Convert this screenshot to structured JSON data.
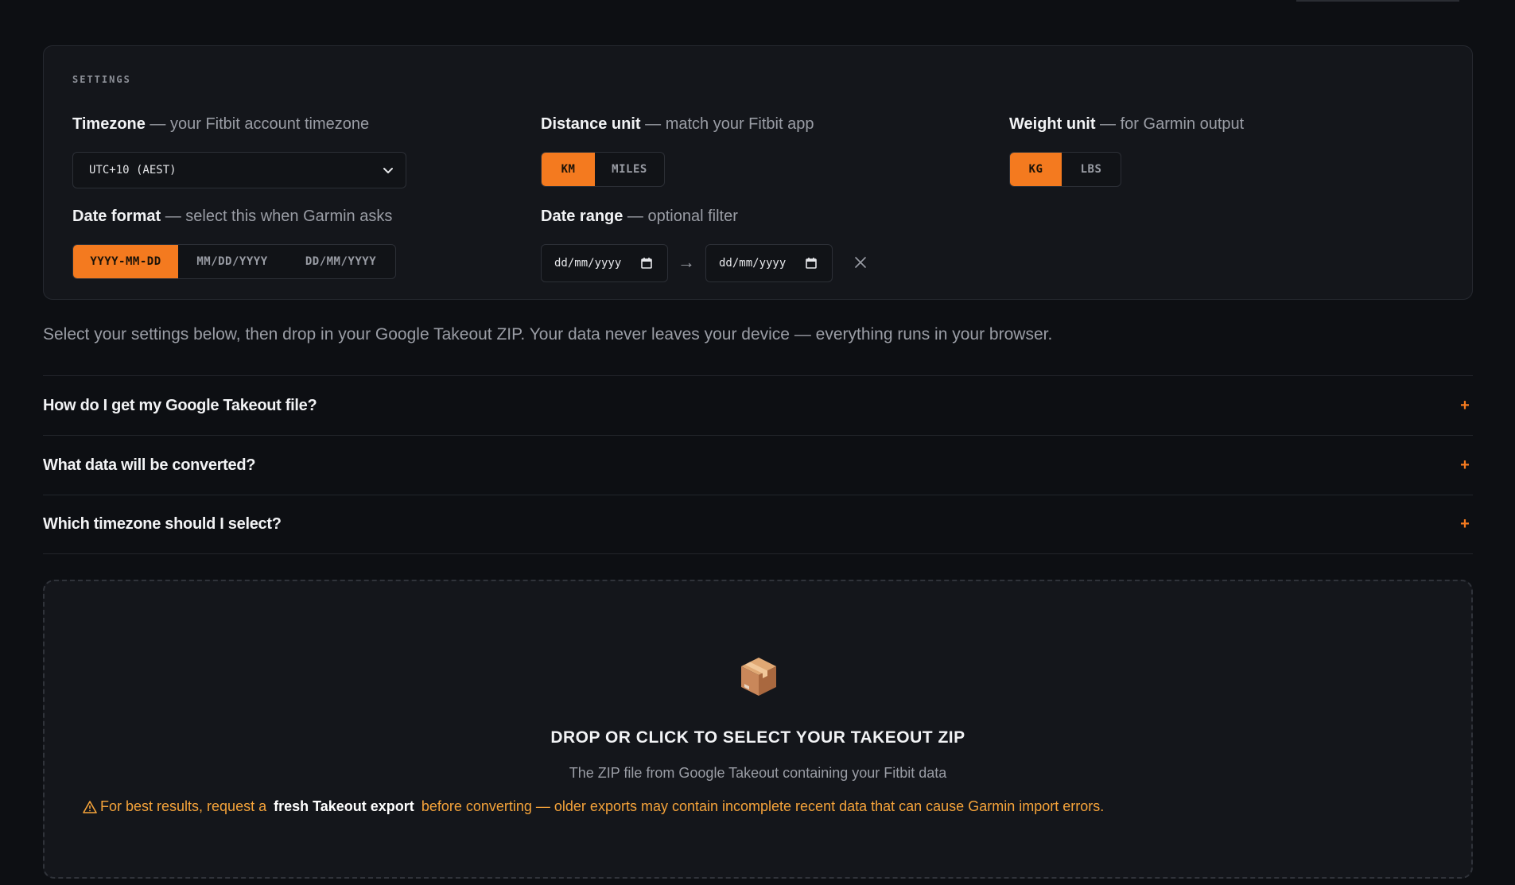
{
  "settings": {
    "heading": "SETTINGS",
    "timezone": {
      "label": "Timezone",
      "hint": " — your Fitbit account timezone",
      "value": "UTC+10 (AEST)"
    },
    "distance_unit": {
      "label": "Distance unit",
      "hint": " — match your Fitbit app",
      "options": [
        "KM",
        "MILES"
      ],
      "selected": "KM"
    },
    "weight_unit": {
      "label": "Weight unit",
      "hint": " — for Garmin output",
      "options": [
        "KG",
        "LBS"
      ],
      "selected": "KG"
    },
    "date_format": {
      "label": "Date format",
      "hint": " — select this when Garmin asks",
      "options": [
        "YYYY-MM-DD",
        "MM/DD/YYYY",
        "DD/MM/YYYY"
      ],
      "selected": "YYYY-MM-DD"
    },
    "date_range": {
      "label": "Date range",
      "hint": " — optional filter",
      "start_placeholder": "dd/mm/yyyy",
      "end_placeholder": "dd/mm/yyyy",
      "arrow": "→"
    }
  },
  "intro_text": "Select your settings below, then drop in your Google Takeout ZIP. Your data never leaves your device — everything runs in your browser.",
  "faq": [
    {
      "question": "How do I get my Google Takeout file?"
    },
    {
      "question": "What data will be converted?"
    },
    {
      "question": "Which timezone should I select?"
    }
  ],
  "faq_toggle": "+",
  "dropzone": {
    "title": "DROP OR CLICK TO SELECT YOUR TAKEOUT ZIP",
    "subtitle": "The ZIP file from Google Takeout containing your Fitbit data",
    "warning_before": "For best results, request a",
    "warning_strong": "fresh Takeout export",
    "warning_after": "before converting — older exports may contain incomplete recent data that can cause Garmin import errors."
  },
  "colors": {
    "accent": "#f47a1f",
    "warning": "#f5a33a",
    "background": "#0d0f13",
    "card": "#14161b"
  }
}
